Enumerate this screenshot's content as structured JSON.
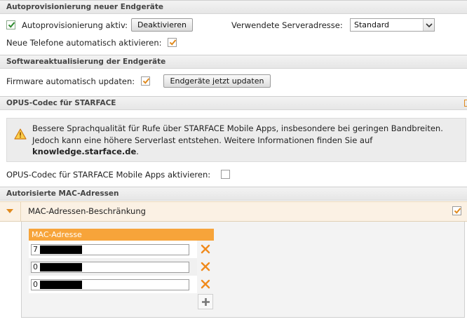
{
  "autoprov": {
    "header": "Autoprovisionierung neuer Endgeräte",
    "active_label": "Autoprovisionierung aktiv:",
    "deactivate_button": "Deaktivieren",
    "server_label": "Verwendete Serveradresse:",
    "server_value": "Standard",
    "new_phones_label": "Neue Telefone automatisch aktivieren:",
    "new_phones_checked": true
  },
  "software": {
    "header": "Softwareaktualisierung der Endgeräte",
    "firmware_label": "Firmware automatisch updaten:",
    "firmware_checked": true,
    "update_button": "Endgeräte jetzt updaten"
  },
  "opus": {
    "header": "OPUS-Codec für STARFACE",
    "warning_line1": "Bessere Sprachqualität für Rufe über STARFACE Mobile Apps, insbesondere bei geringen Bandbreiten.",
    "warning_line2": "Jedoch kann eine höhere Serverlast entstehen. Weitere Informationen finden Sie auf",
    "warning_link": "knowledge.starface.de",
    "warning_period": ".",
    "activate_label": "OPUS-Codec für STARFACE Mobile Apps aktivieren:",
    "activate_checked": false
  },
  "mac": {
    "header": "Autorisierte MAC-Adressen",
    "restriction_label": "MAC-Adressen-Beschränkung",
    "restriction_checked": true,
    "column_header": "MAC-Adresse",
    "rows": [
      {
        "value": "7"
      },
      {
        "value": "0"
      },
      {
        "value": "0"
      }
    ]
  },
  "colors": {
    "accent_orange": "#f7a43a",
    "check_green": "#2e8b2e",
    "check_orange": "#e08a1e",
    "delete_orange": "#f08a1c"
  },
  "icons": {
    "warning": "warning-triangle-icon",
    "collapse": "chevron-down-icon",
    "delete": "close-icon",
    "add": "plus-icon"
  }
}
